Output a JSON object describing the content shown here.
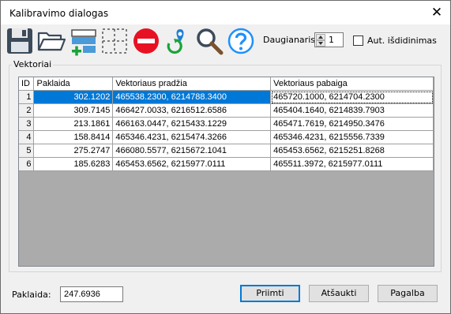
{
  "window": {
    "title": "Kalibravimo dialogas",
    "close_glyph": "✕"
  },
  "toolbar": {
    "icons": [
      "save-icon",
      "open-folder-icon",
      "add-row-icon",
      "select-region-icon",
      "delete-icon",
      "refresh-location-icon",
      "search-icon",
      "help-icon"
    ],
    "degree_label": "Daugianaris",
    "degree_value": "1",
    "auto_smooth_label": "Aut. išdidinimas",
    "auto_smooth_checked": false
  },
  "group": {
    "title": "Vektoriai"
  },
  "table": {
    "columns": [
      "ID",
      "Paklaida",
      "Vektoriaus pradžia",
      "Vektoriaus pabaiga"
    ],
    "rows": [
      {
        "id": "1",
        "error": "302.1202",
        "start": "465538.2300, 6214788.3400",
        "end": "465720.1000, 6214704.2300",
        "selected": true
      },
      {
        "id": "2",
        "error": "309.7145",
        "start": "466427.0033, 6216512.6586",
        "end": "465404.1640, 6214839.7903"
      },
      {
        "id": "3",
        "error": "213.1861",
        "start": "466163.0447, 6215433.1229",
        "end": "465471.7619, 6214950.3476"
      },
      {
        "id": "4",
        "error": "158.8414",
        "start": "465346.4231, 6215474.3266",
        "end": "465346.4231, 6215556.7339"
      },
      {
        "id": "5",
        "error": "275.2747",
        "start": "466080.5577, 6215672.1041",
        "end": "465453.6562, 6215251.8268"
      },
      {
        "id": "6",
        "error": "185.6283",
        "start": "465453.6562, 6215977.0111",
        "end": "465511.3972, 6215977.0111"
      }
    ]
  },
  "footer": {
    "error_label": "Paklaida:",
    "error_value": "247.6936",
    "accept_label": "Priimti",
    "cancel_label": "Atšaukti",
    "help_label": "Pagalba"
  },
  "colors": {
    "selection": "#0078d7",
    "grid_empty": "#ababab",
    "delete_red": "#e81123",
    "help_blue": "#1e90ff",
    "green_plus": "#1aa33a"
  }
}
